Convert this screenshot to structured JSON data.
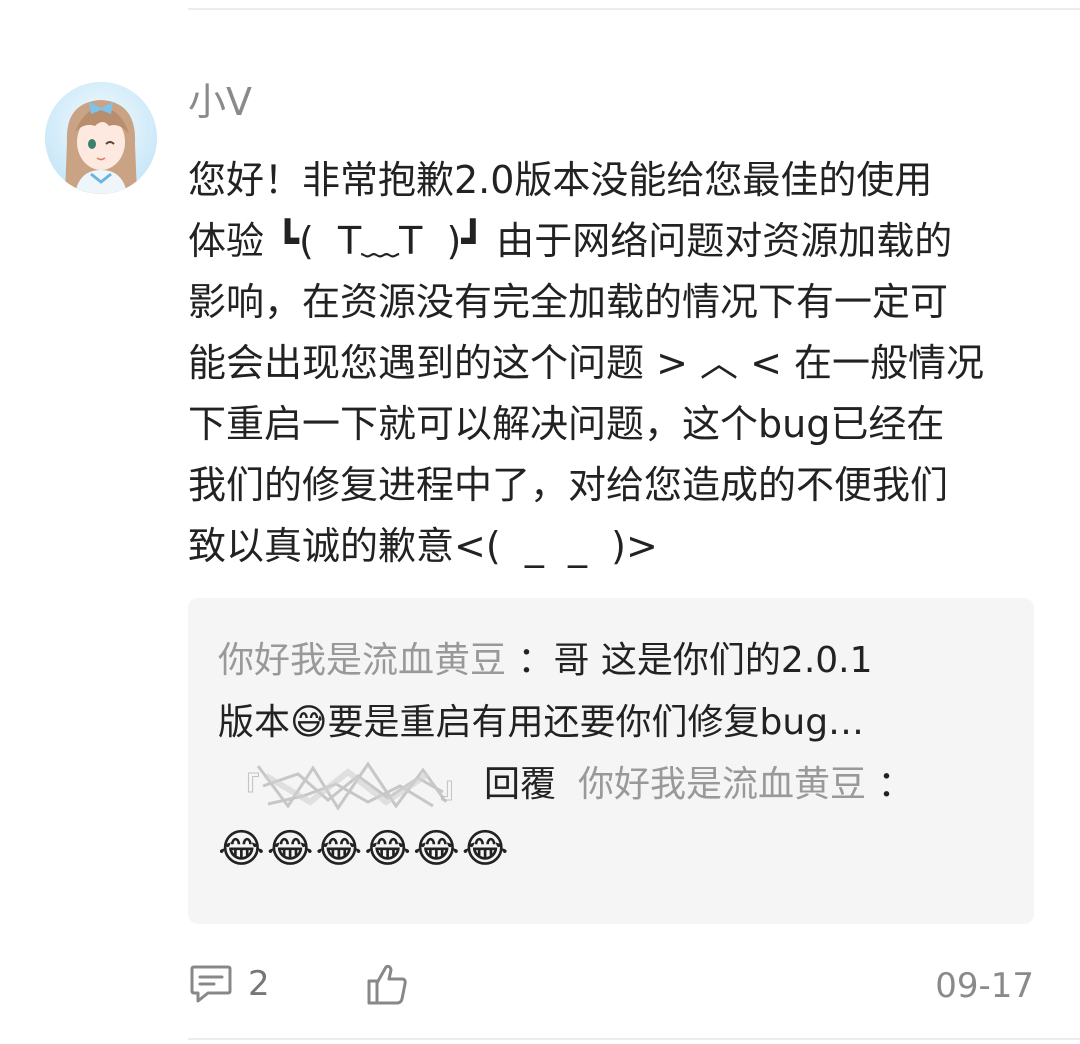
{
  "comment": {
    "username": "小V",
    "text": "您好！非常抱歉2.0版本没能给您最佳的使用\n体验 ┗(  T﹏T  )┛ 由于网络问题对资源加载的\n影响，在资源没有完全加载的情况下有一定可\n能会出现您遇到的这个问题 > ︿ < 在一般情况\n下重启一下就可以解决问题，这个bug已经在\n我们的修复进程中了，对给您造成的不便我们\n致以真诚的歉意<(  _  _  )>",
    "avatar_icon": "anime-girl-avatar"
  },
  "replies": {
    "reply1": {
      "author": "你好我是流血黄豆",
      "colon": " ：",
      "line1_text": "哥  这是你们的2.0.1",
      "line2_text": "版本😅要是重启有用还要你们修复bug…"
    },
    "reply2": {
      "author_blurred_prefix": "『",
      "author_blurred_suffix": "』",
      "verb": "回覆",
      "target": "你好我是流血黄豆",
      "colon": " ：",
      "emojis": "😂😂😂😂😂😂"
    }
  },
  "actions": {
    "comment_icon": "comment-bubble-icon",
    "comment_count": "2",
    "like_icon": "thumbs-up-icon",
    "date": "09-17"
  },
  "colors": {
    "username": "#8a8a8a",
    "reply_bg": "#f5f5f5",
    "reply_name": "#999999",
    "icon": "#888888"
  }
}
